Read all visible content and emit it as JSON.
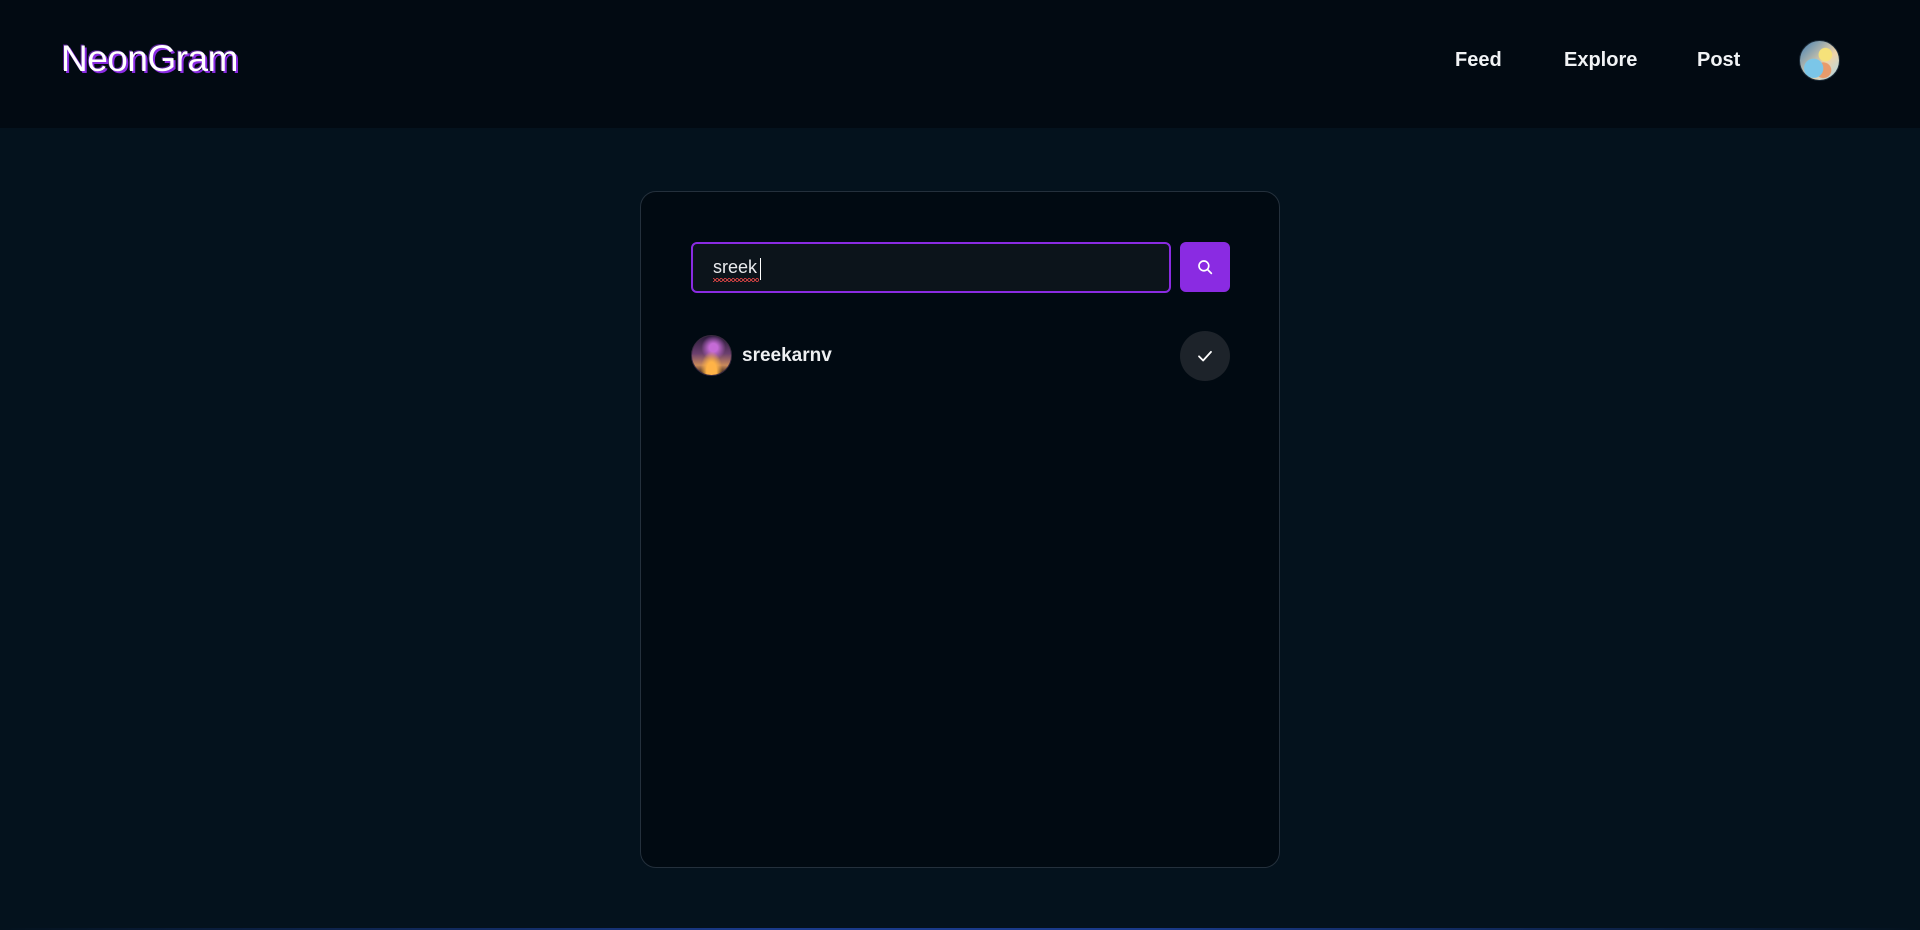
{
  "header": {
    "logo": "NeonGram",
    "nav": {
      "feed": "Feed",
      "explore": "Explore",
      "post": "Post"
    },
    "avatar_icon": "user-avatar-icon"
  },
  "search": {
    "value": "sreek",
    "button_icon": "search-icon"
  },
  "results": [
    {
      "username": "sreekarnv",
      "avatar_icon": "user-avatar-icon",
      "action_icon": "check-icon"
    }
  ],
  "colors": {
    "accent": "#8a2be2",
    "background": "#04121d",
    "navbar": "#020a12",
    "card": "#010a12"
  }
}
